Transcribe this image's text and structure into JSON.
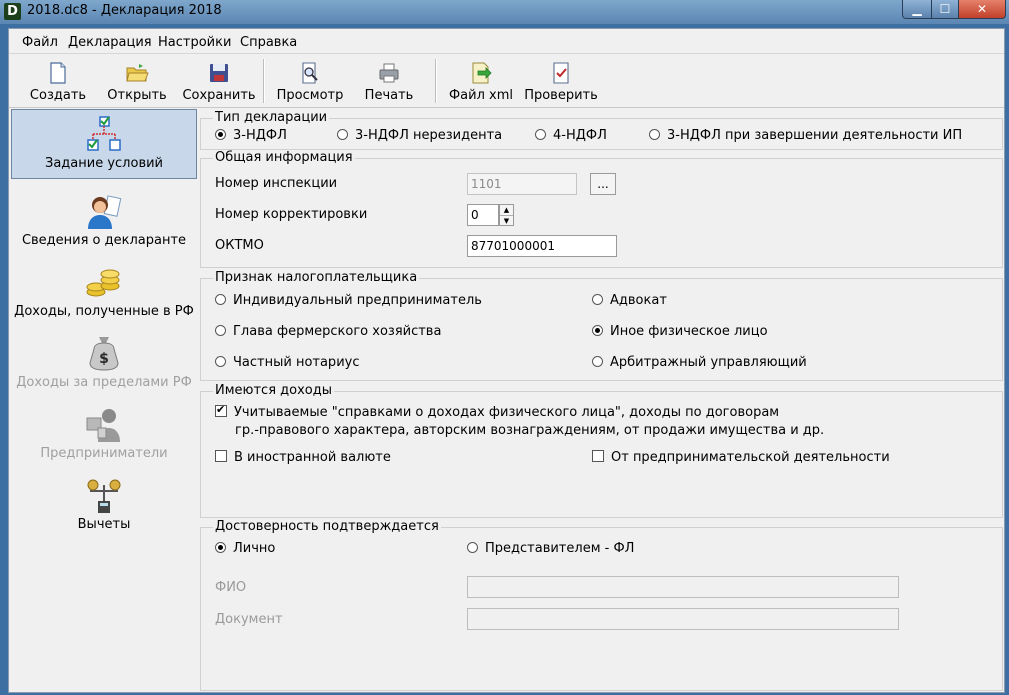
{
  "window": {
    "title": "2018.dc8 - Декларация 2018",
    "app_icon": "D"
  },
  "menu": [
    "Файл",
    "Декларация",
    "Настройки",
    "Справка"
  ],
  "toolbar": {
    "create": "Создать",
    "open": "Открыть",
    "save": "Сохранить",
    "preview": "Просмотр",
    "print": "Печать",
    "xml": "Файл xml",
    "check": "Проверить"
  },
  "nav": {
    "conditions": "Задание условий",
    "declarant": "Сведения о декларанте",
    "income_rf": "Доходы, полученные в РФ",
    "income_abroad": "Доходы за пределами РФ",
    "entrepreneurs": "Предприниматели",
    "deductions": "Вычеты"
  },
  "decl_type": {
    "title": "Тип декларации",
    "options": [
      "3-НДФЛ",
      "3-НДФЛ нерезидента",
      "4-НДФЛ",
      "3-НДФЛ при завершении деятельности ИП"
    ]
  },
  "general": {
    "title": "Общая информация",
    "inspection_label": "Номер инспекции",
    "inspection_value": "1101",
    "browse": "...",
    "correction_label": "Номер корректировки",
    "correction_value": "0",
    "oktmo_label": "ОКТМО",
    "oktmo_value": "87701000001"
  },
  "taxpayer": {
    "title": "Признак налогоплательщика",
    "ip": "Индивидуальный предприниматель",
    "lawyer": "Адвокат",
    "farm": "Глава фермерского хозяйства",
    "other": "Иное физическое лицо",
    "notary": "Частный нотариус",
    "arbitr": "Арбитражный управляющий"
  },
  "incomes": {
    "title": "Имеются доходы",
    "main_line1": "Учитываемые \"справками о доходах физического лица\", доходы по договорам",
    "main_line2": "гр.-правового характера, авторским вознаграждениям, от продажи имущества и др.",
    "foreign": "В иностранной валюте",
    "business": "От предпринимательской деятельности"
  },
  "confirm": {
    "title": "Достоверность подтверждается",
    "personal": "Лично",
    "representative": "Представителем - ФЛ",
    "fio_label": "ФИО",
    "doc_label": "Документ"
  }
}
